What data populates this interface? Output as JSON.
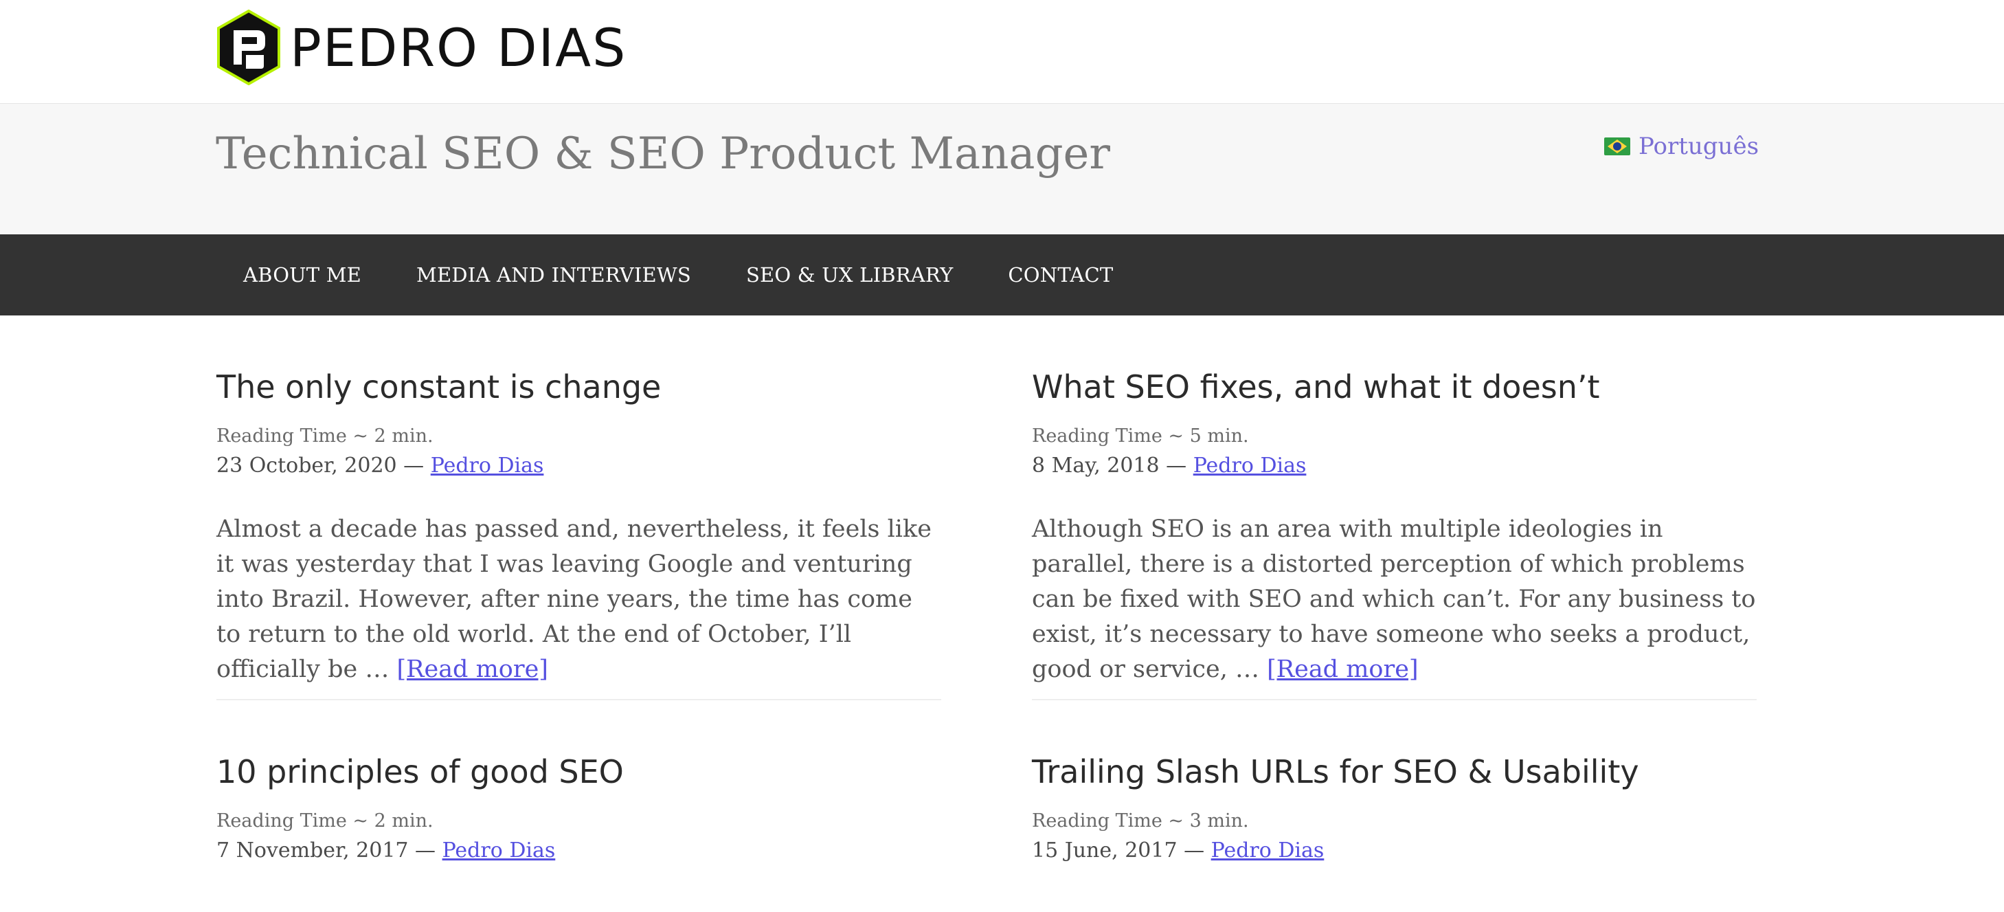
{
  "site": {
    "logo_text": "PEDRO DIAS",
    "tagline": "Technical SEO & SEO Product Manager",
    "language_link": "Português"
  },
  "nav": {
    "items": [
      "ABOUT ME",
      "MEDIA AND INTERVIEWS",
      "SEO & UX LIBRARY",
      "CONTACT"
    ]
  },
  "posts": [
    {
      "title": "The only constant is change",
      "reading_time": "Reading Time ~ 2 min.",
      "date": "23 October, 2020 —",
      "author": "Pedro Dias",
      "excerpt": "Almost a decade has passed and, nevertheless, it feels like it was yesterday that I was leaving Google and venturing into Brazil. However, after nine years, the time has come to return to the old world. At the end of October, I’ll officially be …",
      "read_more": "[Read more]"
    },
    {
      "title": "What SEO fixes, and what it doesn’t",
      "reading_time": "Reading Time ~ 5 min.",
      "date": "8 May, 2018 —",
      "author": "Pedro Dias",
      "excerpt": "Although SEO is an area with multiple ideologies in parallel, there is a distorted perception of which problems can be fixed with SEO and which can’t. For any business to exist, it’s necessary to have someone who seeks a product, good or service, …",
      "read_more": "[Read more]"
    },
    {
      "title": "10 principles of good SEO",
      "reading_time": "Reading Time ~ 2 min.",
      "date": "7 November, 2017 —",
      "author": "Pedro Dias"
    },
    {
      "title": "Trailing Slash URLs for SEO & Usability",
      "reading_time": "Reading Time ~ 3 min.",
      "date": "15 June, 2017 —",
      "author": "Pedro Dias"
    }
  ],
  "colors": {
    "nav_bg": "#333333",
    "tagline_bg": "#f7f7f7",
    "link": "#5550e0",
    "logo_accent": "#b6f000"
  }
}
